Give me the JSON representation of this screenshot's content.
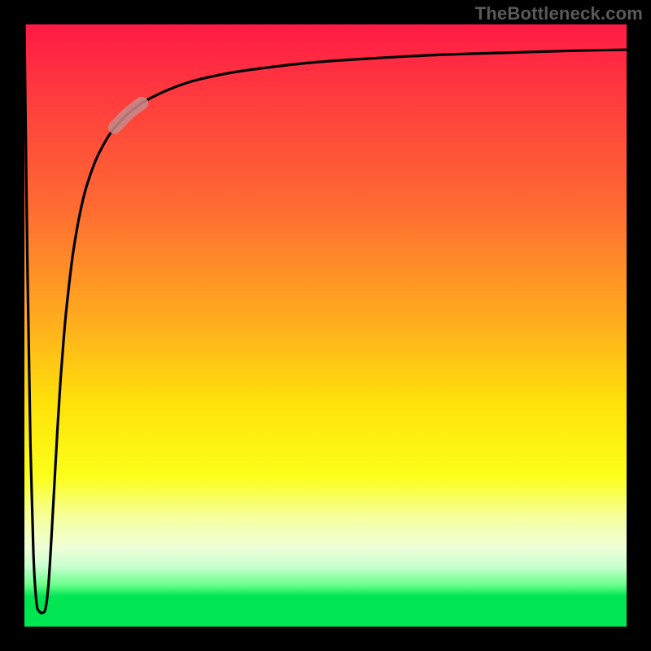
{
  "watermark": "TheBottleneck.com",
  "chart_data": {
    "type": "line",
    "title": "",
    "xlabel": "",
    "ylabel": "",
    "xlim": [
      0,
      100
    ],
    "ylim": [
      0,
      100
    ],
    "grid": false,
    "series": [
      {
        "name": "main-curve",
        "x": [
          0.0,
          0.5,
          1.0,
          1.5,
          2.0,
          2.5,
          3.0,
          3.5,
          4.0,
          4.5,
          5.0,
          5.5,
          6.0,
          6.5,
          7.0,
          8.0,
          9.0,
          10.0,
          11.0,
          12.0,
          13.0,
          14.0,
          15.0,
          17.0,
          19.0,
          21.0,
          24.0,
          27.0,
          30.0,
          35.0,
          40.0,
          46.0,
          52.0,
          60.0,
          70.0,
          80.0,
          90.0,
          100.0
        ],
        "y": [
          100.0,
          60.0,
          30.0,
          12.0,
          4.0,
          2.5,
          2.3,
          3.0,
          7.0,
          15.0,
          24.0,
          33.0,
          41.0,
          47.5,
          53.0,
          61.5,
          67.5,
          72.0,
          75.2,
          77.8,
          79.8,
          81.5,
          82.9,
          85.0,
          86.6,
          87.8,
          89.2,
          90.3,
          91.1,
          92.1,
          92.8,
          93.5,
          94.0,
          94.5,
          95.0,
          95.3,
          95.6,
          95.8
        ]
      }
    ],
    "highlight_segment": {
      "x_start": 15.0,
      "x_end": 19.5,
      "y_start_approx": 73.5,
      "y_end_approx": 78.0
    }
  }
}
